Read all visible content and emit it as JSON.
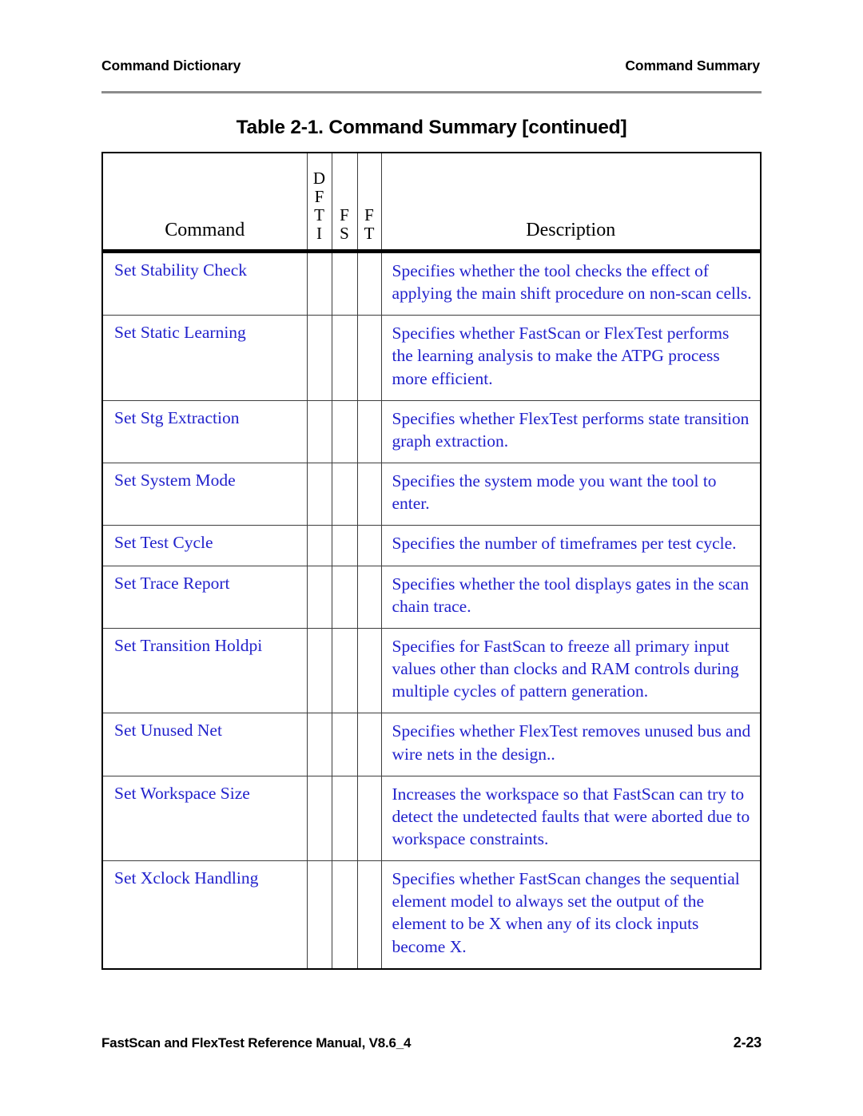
{
  "running_head": {
    "left": "Command Dictionary",
    "right": "Command Summary"
  },
  "table_title": "Table 2-1. Command Summary [continued]",
  "table": {
    "headers": {
      "command": "Command",
      "dfti": [
        "D",
        "F",
        "T",
        "I"
      ],
      "fs": [
        "F",
        "S"
      ],
      "ft": [
        "F",
        "T"
      ],
      "description": "Description"
    },
    "rows": [
      {
        "command": "Set Stability Check",
        "dfti": "",
        "fs": "",
        "ft": "",
        "description": "Specifies whether the tool checks the effect of applying the main shift procedure on non-scan cells."
      },
      {
        "command": "Set Static Learning",
        "dfti": "",
        "fs": "",
        "ft": "",
        "description": "Specifies whether FastScan or FlexTest performs the learning analysis to make the ATPG process more efficient."
      },
      {
        "command": "Set Stg Extraction",
        "dfti": "",
        "fs": "",
        "ft": "",
        "description": "Specifies whether FlexTest performs state transition graph extraction."
      },
      {
        "command": "Set System Mode",
        "dfti": "",
        "fs": "",
        "ft": "",
        "description": "Specifies the system mode you want the tool to enter."
      },
      {
        "command": "Set Test Cycle",
        "dfti": "",
        "fs": "",
        "ft": "",
        "description": "Specifies the number of timeframes per test cycle."
      },
      {
        "command": "Set Trace Report",
        "dfti": "",
        "fs": "",
        "ft": "",
        "description": "Specifies whether the tool displays gates in the scan chain trace."
      },
      {
        "command": "Set Transition Holdpi",
        "dfti": "",
        "fs": "",
        "ft": "",
        "description": "Specifies for FastScan to freeze all primary input values other than clocks and RAM controls during multiple cycles of pattern generation."
      },
      {
        "command": "Set Unused Net",
        "dfti": "",
        "fs": "",
        "ft": "",
        "description": "Specifies whether FlexTest removes unused bus and wire nets in the design.."
      },
      {
        "command": "Set Workspace Size",
        "dfti": "",
        "fs": "",
        "ft": "",
        "description": "Increases the workspace so that FastScan can try to detect the undetected faults that were aborted due to workspace constraints."
      },
      {
        "command": "Set Xclock Handling",
        "dfti": "",
        "fs": "",
        "ft": "",
        "description": "Specifies whether FastScan changes the sequential element model to always set the output of the element to be X when any of its clock inputs become X."
      }
    ]
  },
  "footer": {
    "manual": "FastScan and FlexTest Reference Manual, V8.6_4",
    "page": "2-23"
  },
  "colors": {
    "link_blue": "#2222cc",
    "rule_gray": "#8c8c8c",
    "border": "#3d3d3d"
  }
}
